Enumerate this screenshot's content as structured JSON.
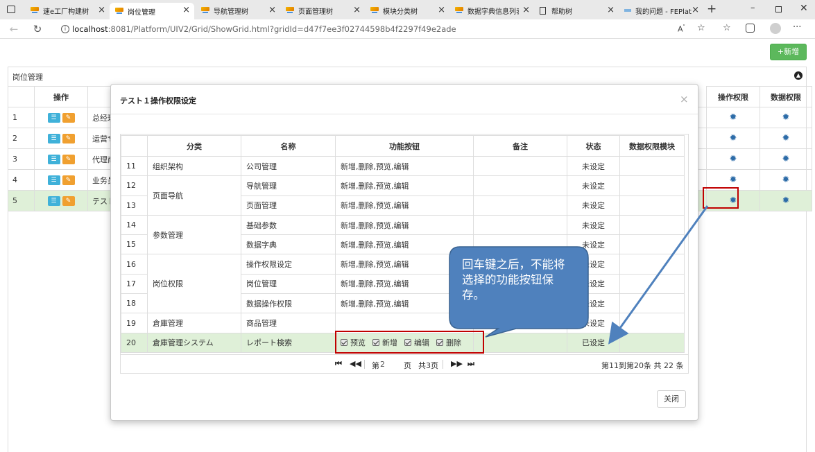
{
  "browser": {
    "tabs": [
      {
        "label": "速e工厂构建树"
      },
      {
        "label": "岗位管理"
      },
      {
        "label": "导航管理树"
      },
      {
        "label": "页面管理树"
      },
      {
        "label": "模块分类树"
      },
      {
        "label": "数据字典信息列表"
      },
      {
        "label": "帮助树"
      },
      {
        "label": "我的问题 - FEPlat"
      }
    ],
    "url_host": "localhost",
    "url_rest": ":8081/Platform/UIV2/Grid/ShowGrid.html?gridId=d47f7ee3f02744598b4f2297f49e2ade"
  },
  "page": {
    "new_button": "+新增",
    "panel_title": "岗位管理",
    "grid_headers": {
      "ops": "操作",
      "op_perm": "操作权限",
      "data_perm": "数据权限"
    },
    "rows": [
      {
        "no": "1",
        "name": "总经理"
      },
      {
        "no": "2",
        "name": "运营专"
      },
      {
        "no": "3",
        "name": "代理商"
      },
      {
        "no": "4",
        "name": "业务员"
      },
      {
        "no": "5",
        "name": "テスト"
      }
    ]
  },
  "modal": {
    "title": "テスト１操作权限设定",
    "close_x": "×",
    "headers": {
      "category": "分类",
      "name": "名称",
      "buttons": "功能按钮",
      "remark": "备注",
      "status": "状态",
      "data_module": "数据权限模块"
    },
    "rows": [
      {
        "no": "11",
        "category": "组织架构",
        "name": "公司管理",
        "buttons": "新增,删除,预览,编辑",
        "status": "未设定"
      },
      {
        "no": "12",
        "category": "页面导航",
        "name": "导航管理",
        "buttons": "新增,删除,预览,编辑",
        "status": "未设定"
      },
      {
        "no": "13",
        "category": "",
        "name": "页面管理",
        "buttons": "新增,删除,预览,编辑",
        "status": "未设定"
      },
      {
        "no": "14",
        "category": "参数管理",
        "name": "基础参数",
        "buttons": "新增,删除,预览,编辑",
        "status": "未设定"
      },
      {
        "no": "15",
        "category": "",
        "name": "数据字典",
        "buttons": "新增,删除,预览,编辑",
        "status": "未设定"
      },
      {
        "no": "16",
        "category": "岗位权限",
        "name": "操作权限设定",
        "buttons": "新增,删除,预览,编辑",
        "status": "未设定"
      },
      {
        "no": "17",
        "category": "",
        "name": "岗位管理",
        "buttons": "新增,删除,预览,编辑",
        "status": "未设定"
      },
      {
        "no": "18",
        "category": "",
        "name": "数据操作权限",
        "buttons": "新增,删除,预览,编辑",
        "status": "未设定"
      },
      {
        "no": "19",
        "category": "倉庫管理",
        "name": "商品管理",
        "buttons": "",
        "status": "未设定"
      },
      {
        "no": "20",
        "category": "倉庫管理システム",
        "name": "レポート検索",
        "status": "已设定"
      }
    ],
    "row20_checkboxes": [
      "预览",
      "新增",
      "编辑",
      "删除"
    ],
    "pager": {
      "page_prefix": "第",
      "page_value": "2",
      "page_suffix": "页",
      "total_pages": "共3页",
      "summary": "第11到第20条   共 22 条"
    },
    "close_button": "关闭"
  },
  "annotation": {
    "callout": "回车键之后，不能将选择的功能按钮保存。",
    "callout_fill": "#4f81bd",
    "highlight_color": "#c00000"
  }
}
